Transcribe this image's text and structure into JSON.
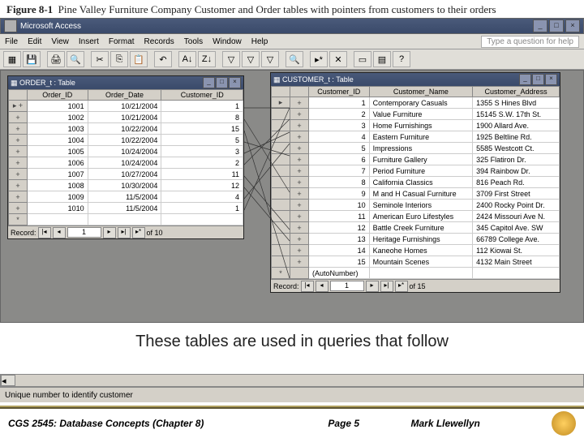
{
  "figure": {
    "label": "Figure 8-1",
    "title": "Pine Valley Furniture Company Customer and Order tables with pointers from customers to their orders"
  },
  "app": {
    "title": "Microsoft Access",
    "help_placeholder": "Type a question for help"
  },
  "menu": {
    "items": [
      "File",
      "Edit",
      "View",
      "Insert",
      "Format",
      "Records",
      "Tools",
      "Window",
      "Help"
    ]
  },
  "order_table": {
    "title": "ORDER_t : Table",
    "columns": [
      "Order_ID",
      "Order_Date",
      "Customer_ID"
    ],
    "rows": [
      {
        "id": "1001",
        "date": "10/21/2004",
        "cust": "1"
      },
      {
        "id": "1002",
        "date": "10/21/2004",
        "cust": "8"
      },
      {
        "id": "1003",
        "date": "10/22/2004",
        "cust": "15"
      },
      {
        "id": "1004",
        "date": "10/22/2004",
        "cust": "5"
      },
      {
        "id": "1005",
        "date": "10/24/2004",
        "cust": "3"
      },
      {
        "id": "1006",
        "date": "10/24/2004",
        "cust": "2"
      },
      {
        "id": "1007",
        "date": "10/27/2004",
        "cust": "11"
      },
      {
        "id": "1008",
        "date": "10/30/2004",
        "cust": "12"
      },
      {
        "id": "1009",
        "date": "11/5/2004",
        "cust": "4"
      },
      {
        "id": "1010",
        "date": "11/5/2004",
        "cust": "1"
      }
    ],
    "nav": {
      "label": "Record:",
      "current": "1",
      "count": "of  10"
    }
  },
  "customer_table": {
    "title": "CUSTOMER_t : Table",
    "columns": [
      "Customer_ID",
      "Customer_Name",
      "Customer_Address"
    ],
    "rows": [
      {
        "id": "1",
        "name": "Contemporary Casuals",
        "addr": "1355 S Hines Blvd"
      },
      {
        "id": "2",
        "name": "Value Furniture",
        "addr": "15145 S.W. 17th St."
      },
      {
        "id": "3",
        "name": "Home Furnishings",
        "addr": "1900 Allard Ave."
      },
      {
        "id": "4",
        "name": "Eastern Furniture",
        "addr": "1925 Beltline Rd."
      },
      {
        "id": "5",
        "name": "Impressions",
        "addr": "5585 Westcott Ct."
      },
      {
        "id": "6",
        "name": "Furniture Gallery",
        "addr": "325 Flatiron Dr."
      },
      {
        "id": "7",
        "name": "Period Furniture",
        "addr": "394 Rainbow Dr."
      },
      {
        "id": "8",
        "name": "California Classics",
        "addr": "816 Peach Rd."
      },
      {
        "id": "9",
        "name": "M and H Casual Furniture",
        "addr": "3709 First Street"
      },
      {
        "id": "10",
        "name": "Seminole Interiors",
        "addr": "2400 Rocky Point Dr."
      },
      {
        "id": "11",
        "name": "American Euro Lifestyles",
        "addr": "2424 Missouri Ave N."
      },
      {
        "id": "12",
        "name": "Battle Creek Furniture",
        "addr": "345 Capitol Ave. SW"
      },
      {
        "id": "13",
        "name": "Heritage Furnishings",
        "addr": "66789 College Ave."
      },
      {
        "id": "14",
        "name": "Kaneohe Homes",
        "addr": "112 Kiowai St."
      },
      {
        "id": "15",
        "name": "Mountain Scenes",
        "addr": "4132 Main Street"
      }
    ],
    "autonumber": "(AutoNumber)",
    "nav": {
      "label": "Record:",
      "current": "1",
      "count": "of  15"
    }
  },
  "caption": "These tables are used in queries that follow",
  "status": "Unique number to identify customer",
  "footer": {
    "course": "CGS 2545: Database Concepts  (Chapter 8)",
    "page": "Page 5",
    "author": "Mark Llewellyn"
  }
}
